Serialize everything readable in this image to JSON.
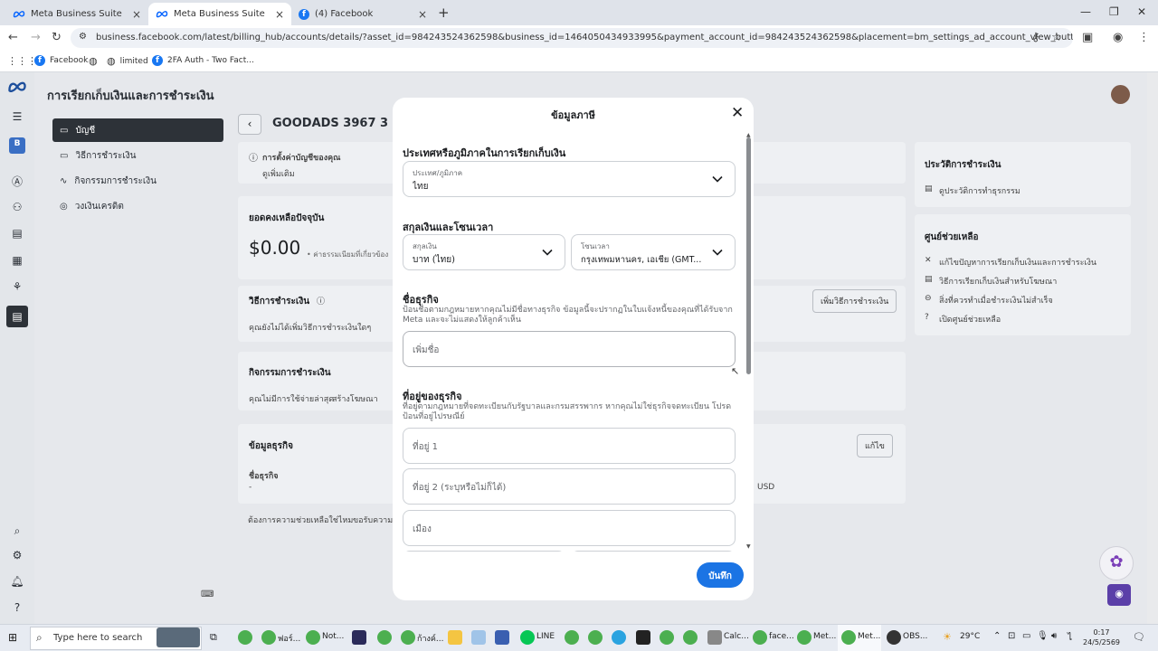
{
  "browser": {
    "tabs": [
      {
        "title": "Meta Business Suite",
        "active": false
      },
      {
        "title": "Meta Business Suite",
        "active": true
      },
      {
        "title": "(4) Facebook",
        "active": false
      }
    ],
    "url": "business.facebook.com/latest/billing_hub/accounts/details/?asset_id=984243524362598&business_id=1464050434933995&payment_account_id=984243524362598&placement=bm_settings_ad_account_view_button&payment_method_id=&entryp...",
    "bookmarks": [
      "Facebook",
      "limited",
      "2FA Auth - Two Fact..."
    ]
  },
  "page": {
    "title": "การเรียกเก็บเงินและการชำระเงิน",
    "account_name": "GOODADS 3967 3",
    "nav": [
      {
        "label": "บัญชี",
        "icon": "wallet-icon",
        "selected": true
      },
      {
        "label": "วิธีการชำระเงิน",
        "icon": "card-icon",
        "selected": false
      },
      {
        "label": "กิจกรรมการชำระเงิน",
        "icon": "activity-icon",
        "selected": false
      },
      {
        "label": "วงเงินเครดิต",
        "icon": "coins-icon",
        "selected": false
      }
    ],
    "setup_notice": "การตั้งค่าบัญชีของคุณ",
    "setup_link": "ดูเพิ่มเติม",
    "balance_title": "ยอดคงเหลือปัจจุบัน",
    "balance_value": "$0.00",
    "balance_note": "• ค่าธรรมเนียมที่เกี่ยวข้อง",
    "payment_methods_title": "วิธีการชำระเงิน",
    "payment_methods_text": "คุณยังไม่ได้เพิ่มวิธีการชำระเงินใดๆ",
    "add_payment_method": "เพิ่มวิธีการชำระเงิน",
    "activity_title": "กิจกรรมการชำระเงิน",
    "activity_text": "คุณไม่มีการใช้จ่ายล่าสุด",
    "activity_link": "สร้างโฆษณา",
    "business_info_title": "ข้อมูลธุรกิจ",
    "business_name_label": "ชื่อธุรกิจ",
    "business_name_value": "-",
    "edit_button": "แก้ไข",
    "currency_value": "USD",
    "help_footer": "ต้องการความช่วยเหลือใช่ไหม",
    "help_footer_link": "ขอรับความ",
    "history_title": "ประวัติการชำระเงิน",
    "history_link": "ดูประวัติการทำธุรกรรม",
    "help_center_title": "ศูนย์ช่วยเหลือ",
    "help_links": [
      "แก้ไขปัญหาการเรียกเก็บเงินและการชำระเงิน",
      "วิธีการเรียกเก็บเงินสำหรับโฆษณา",
      "สิ่งที่ควรทำเมื่อชำระเงินไม่สำเร็จ",
      "เปิดศูนย์ช่วยเหลือ"
    ]
  },
  "modal": {
    "title": "ข้อมูลภาษี",
    "section_country": "ประเทศหรือภูมิภาคในการเรียกเก็บเงิน",
    "country_label": "ประเทศ/ภูมิภาค",
    "country_value": "ไทย",
    "section_currency": "สกุลเงินและโซนเวลา",
    "currency_label": "สกุลเงิน",
    "currency_value": "บาท (ไทย)",
    "timezone_label": "โซนเวลา",
    "timezone_value": "กรุงเทพมหานคร, เอเชีย (GMT...",
    "section_name": "ชื่อธุรกิจ",
    "name_desc": "ป้อนชื่อตามกฎหมายหากคุณไม่มีชื่อทางธุรกิจ ข้อมูลนี้จะปรากฏในใบแจ้งหนี้ของคุณที่ได้รับจาก Meta และจะไม่แสดงให้ลูกค้าเห็น",
    "name_placeholder": "เพิ่มชื่อ",
    "section_address": "ที่อยู่ของธุรกิจ",
    "address_desc": "ที่อยู่ตามกฎหมายที่จดทะเบียนกับรัฐบาลและกรมสรรพากร หากคุณไม่ใช่ธุรกิจจดทะเบียน โปรดป้อนที่อยู่ไปรษณีย์",
    "address1_placeholder": "ที่อยู่ 1",
    "address2_placeholder": "ที่อยู่ 2 (ระบุหรือไม่ก็ได้)",
    "city_placeholder": "เมือง",
    "save_button": "บันทึก"
  },
  "taskbar": {
    "search_placeholder": "Type here to search",
    "apps": [
      "ฟอร์...",
      "Not...",
      "ก้างค์...",
      "LINE",
      "Calc...",
      "face...",
      "Met...",
      "Met...",
      "OBS..."
    ],
    "weather": "29°C",
    "time": "0:17",
    "date": "24/5/2569"
  }
}
